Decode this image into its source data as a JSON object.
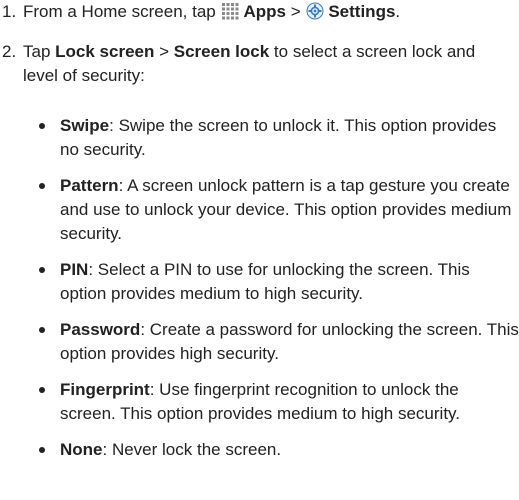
{
  "steps": [
    {
      "num": "1.",
      "prefix": "From a Home screen, tap ",
      "apps_label": "Apps",
      "separator": " > ",
      "settings_label": "Settings",
      "suffix": "."
    },
    {
      "num": "2.",
      "prefix": "Tap ",
      "lock_screen": "Lock screen",
      "separator": " > ",
      "screen_lock": "Screen lock",
      "suffix": " to select a screen lock and level of security:"
    }
  ],
  "options": [
    {
      "term": "Swipe",
      "desc": ": Swipe the screen to unlock it. This option provides no security."
    },
    {
      "term": "Pattern",
      "desc": ": A screen unlock pattern is a tap gesture you create and use to unlock your device. This option provides medium security."
    },
    {
      "term": "PIN",
      "desc": ": Select a PIN to use for unlocking the screen. This option provides medium to high security."
    },
    {
      "term": "Password",
      "desc": ": Create a password for unlocking the screen. This option provides high security."
    },
    {
      "term": "Fingerprint",
      "desc": ": Use fingerprint recognition to unlock the screen. This option provides medium to high security."
    },
    {
      "term": "None",
      "desc": ": Never lock the screen."
    }
  ],
  "colors": {
    "text": "#222222",
    "apps_icon": "#8a8a8a",
    "settings_icon": "#3a7bbf"
  },
  "icons": {
    "apps": "apps-grid-icon",
    "settings": "settings-gear-icon"
  }
}
